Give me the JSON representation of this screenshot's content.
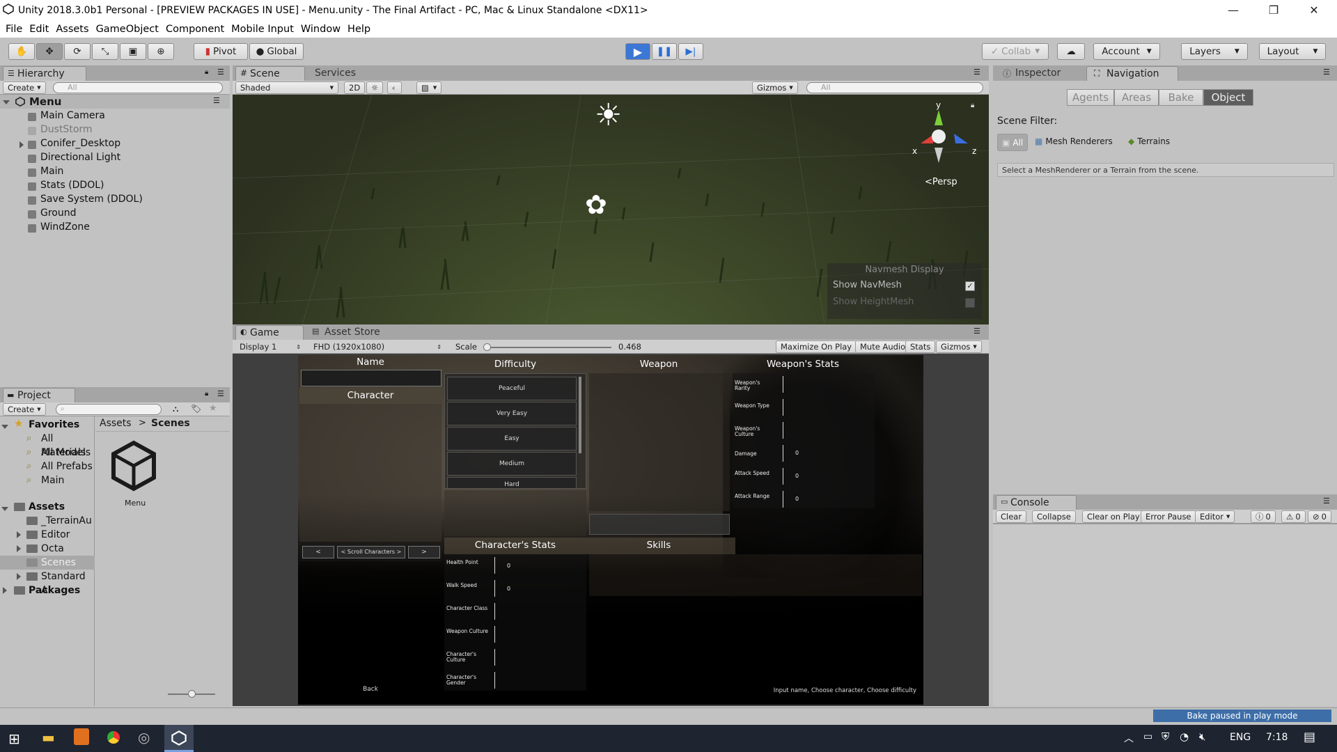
{
  "window": {
    "title": "Unity 2018.3.0b1 Personal - [PREVIEW PACKAGES IN USE] - Menu.unity - The Final Artifact - PC, Mac & Linux Standalone <DX11>",
    "minimize": "—",
    "maximize": "❐",
    "close": "✕"
  },
  "menu": [
    "File",
    "Edit",
    "Assets",
    "GameObject",
    "Component",
    "Mobile Input",
    "Window",
    "Help"
  ],
  "toolbar": {
    "pivot": "Pivot",
    "global": "Global",
    "collab": "Collab",
    "account": "Account",
    "layers": "Layers",
    "layout": "Layout"
  },
  "hierarchy": {
    "tab": "Hierarchy",
    "create": "Create",
    "search_placeholder": "All",
    "scene": "Menu",
    "items": [
      "Main Camera",
      "DustStorm",
      "Conifer_Desktop",
      "Directional Light",
      "Main",
      "Stats (DDOL)",
      "Save System (DDOL)",
      "Ground",
      "WindZone"
    ]
  },
  "project": {
    "tab": "Project",
    "create": "Create",
    "favorites": "Favorites",
    "favorites_items": [
      "All Materials",
      "All Models",
      "All Prefabs",
      "Main"
    ],
    "assets": "Assets",
    "assets_items": [
      "_TerrainAu",
      "Editor",
      "Octa Intera",
      "Scenes",
      "Standard A"
    ],
    "packages": "Packages",
    "breadcrumb_root": "Assets",
    "breadcrumb_sep": ">",
    "breadcrumb_current": "Scenes",
    "asset_name": "Menu"
  },
  "scene": {
    "tab": "Scene",
    "services_tab": "Services",
    "shading": "Shaded",
    "mode2d": "2D",
    "gizmos": "Gizmos",
    "search_placeholder": "All",
    "persp": "Persp",
    "axis_y": "y",
    "axis_x": "x",
    "axis_z": "z",
    "navmesh_title": "Navmesh Display",
    "show_navmesh": "Show NavMesh",
    "show_heightmesh": "Show HeightMesh"
  },
  "game": {
    "tab": "Game",
    "asset_store_tab": "Asset Store",
    "display": "Display 1",
    "resolution": "FHD (1920x1080)",
    "scale_label": "Scale",
    "scale_value": "0.468",
    "maximize_on_play": "Maximize On Play",
    "mute_audio": "Mute Audio",
    "stats": "Stats",
    "gizmos": "Gizmos",
    "ui": {
      "name_label": "Name",
      "character_label": "Character",
      "difficulty_label": "Difficulty",
      "weapon_label": "Weapon",
      "weapon_stats_label": "Weapon's Stats",
      "difficulties": [
        "Peaceful",
        "Very Easy",
        "Easy",
        "Medium",
        "Hard"
      ],
      "weapon_stats": [
        {
          "label": "Weapon's Rarity",
          "value": ""
        },
        {
          "label": "Weapon Type",
          "value": ""
        },
        {
          "label": "Weapon's Culture",
          "value": ""
        },
        {
          "label": "Damage",
          "value": "0"
        },
        {
          "label": "Attack Speed",
          "value": "0"
        },
        {
          "label": "Attack Range",
          "value": "0"
        }
      ],
      "prev_btn": "<",
      "scroll_characters": "< Scroll Characters >",
      "next_btn": ">",
      "character_stats_label": "Character's Stats",
      "skills_label": "Skills",
      "character_stats": [
        {
          "label": "Health Point",
          "value": "0"
        },
        {
          "label": "Walk Speed",
          "value": "0"
        },
        {
          "label": "Character Class",
          "value": ""
        },
        {
          "label": "Weapon Culture",
          "value": ""
        },
        {
          "label": "Character's Culture",
          "value": ""
        },
        {
          "label": "Character's Gender",
          "value": ""
        }
      ],
      "back": "Back",
      "hint": "Input name, Choose character, Choose difficulty"
    }
  },
  "inspector": {
    "inspector_tab": "Inspector",
    "navigation_tab": "Navigation",
    "nav_buttons": [
      "Agents",
      "Areas",
      "Bake",
      "Object"
    ],
    "scene_filter_label": "Scene Filter:",
    "filters": [
      "All",
      "Mesh Renderers",
      "Terrains"
    ],
    "help_text": "Select a MeshRenderer or a Terrain from the scene."
  },
  "console": {
    "tab": "Console",
    "buttons": [
      "Clear",
      "Collapse",
      "Clear on Play",
      "Error Pause",
      "Editor"
    ],
    "counts": [
      "0",
      "0",
      "0"
    ]
  },
  "statusbar": {
    "bake_status": "Bake paused in play mode"
  },
  "taskbar": {
    "lang": "ENG",
    "time": "7:18"
  }
}
